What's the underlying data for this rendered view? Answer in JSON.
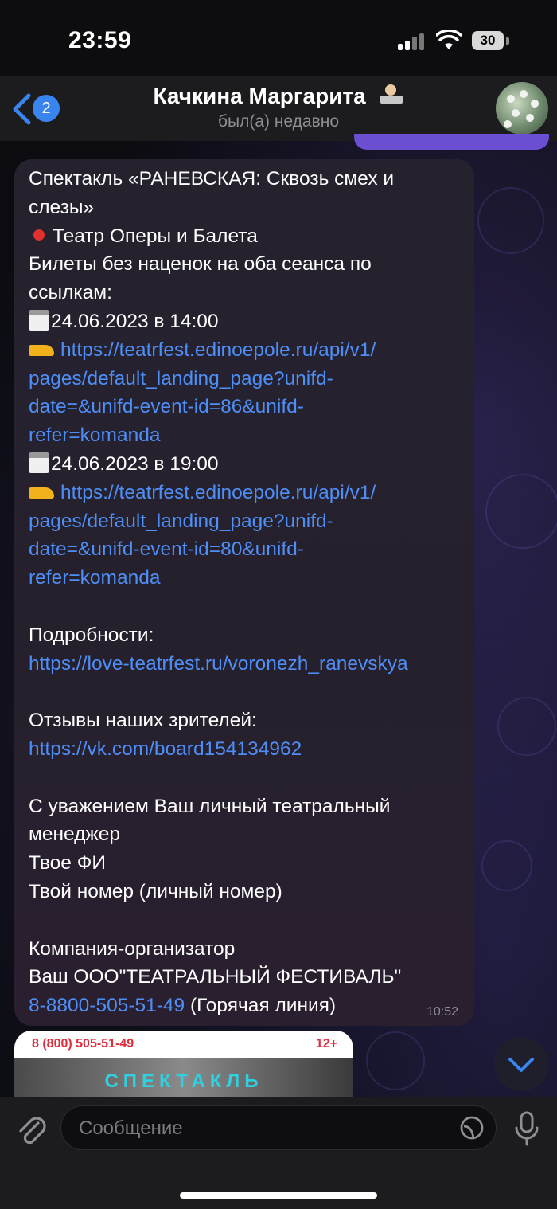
{
  "status_bar": {
    "time": "23:59",
    "battery": "30"
  },
  "header": {
    "back_badge": "2",
    "contact_name": "Качкина Маргарита",
    "contact_status": "был(а) недавно",
    "icons": [
      "back-chevron-icon",
      "laptop-person-emoji",
      "avatar"
    ]
  },
  "message": {
    "lines": {
      "l1": "Спектакль «РАНЕВСКАЯ: Сквозь смех и",
      "l2": "слезы»",
      "l3": "Театр Оперы и Балета",
      "l4": "Билеты без наценок на оба сеанса по",
      "l5": "ссылкам:",
      "l6": "24.06.2023 в 14:00",
      "l7": "https://teatrfest.edinoepole.ru/api/v1/",
      "l8": "pages/default_landing_page?unifd-",
      "l9": "date=&unifd-event-id=86&unifd-",
      "l10": "refer=komanda",
      "l11": "24.06.2023 в 19:00",
      "l12": "https://teatrfest.edinoepole.ru/api/v1/",
      "l13": "pages/default_landing_page?unifd-",
      "l14": "date=&unifd-event-id=80&unifd-",
      "l15": "refer=komanda",
      "l16": "Подробности:",
      "l17": "https://love-teatrfest.ru/voronezh_ranevskya",
      "l18": "Отзывы наших зрителей:",
      "l19": "https://vk.com/board154134962",
      "l20": "С уважением Ваш личный театральный",
      "l21": "менеджер",
      "l22": "Твое ФИ",
      "l23": "Твой номер (личный номер)",
      "l24": "Компания-организатор",
      "l25": "Ваш ООО\"ТЕАТРАЛЬНЫЙ ФЕСТИВАЛЬ\"",
      "l26_phone": "8-8800-505-51-49",
      "l26_rest": " (Горячая линия)"
    },
    "time": "10:52"
  },
  "preview": {
    "phone": "8 (800) 505-51-49",
    "age": "12+",
    "title": "СПЕКТАКЛЬ"
  },
  "input": {
    "placeholder": "Сообщение"
  },
  "colors": {
    "link": "#4e8ef7",
    "accent": "#3a84f0",
    "outgoing": "#6a4fd0",
    "bubble": "#25222e"
  }
}
